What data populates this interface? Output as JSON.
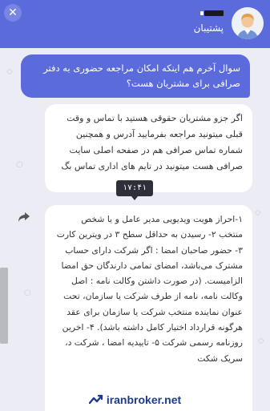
{
  "header": {
    "title": "پشتیبان",
    "close_label": "✕"
  },
  "messages": {
    "user_question": "سوال آخرم هم اینکه امکان مراجعه حضوری به دفتر صرافی برای مشتریان هست؟",
    "bot_reply_1": "اگر جزو مشتریان حقوقی هستید با تماس و وقت قبلی میتونید مراجعه بفرمایید آدرس و همچنین شماره تماس صرافی هم در صفحه اصلی سایت صرافی هست میتونید در تایم های اداری تماس بگ",
    "bot_reply_2": "۱-احراز هویت ویدیویی مدیر عامل و یا شخص منتخب ۲- رسیدن به حداقل سطح ۳ در ویترین کارت ۳- حضور صاحبان امضا : اگر شرکت دارای حساب مشترک می‌باشد، امضای تمامی دارندگان حق امضا الزامیست. (در صورت داشتن وکالت نامه : اصل وکالت نامه، نامه از طرف شرکت یا سازمان، تحت عنوان نماینده منتخب شرکت یا سازمان برای عقد هرگونه قرارداد اختیار کامل داشته باشد). ۴- اخرین روزنامه رسمی شرکت ۵- تاییدیه امضا ، شرکت د، سریک شکت",
    "timestamp": "۱۷:۴۱"
  },
  "watermark": {
    "text": "iranbroker.net"
  },
  "colors": {
    "header": "#5b6bdc",
    "user_bubble": "#5b6bdc",
    "chat_bg": "#ececf4",
    "tooltip": "#2f2f3a",
    "brand": "#1f3a8a"
  },
  "icons": {
    "close": "close-icon",
    "avatar": "support-avatar",
    "share": "share-icon",
    "brand": "iranbroker-logo"
  }
}
